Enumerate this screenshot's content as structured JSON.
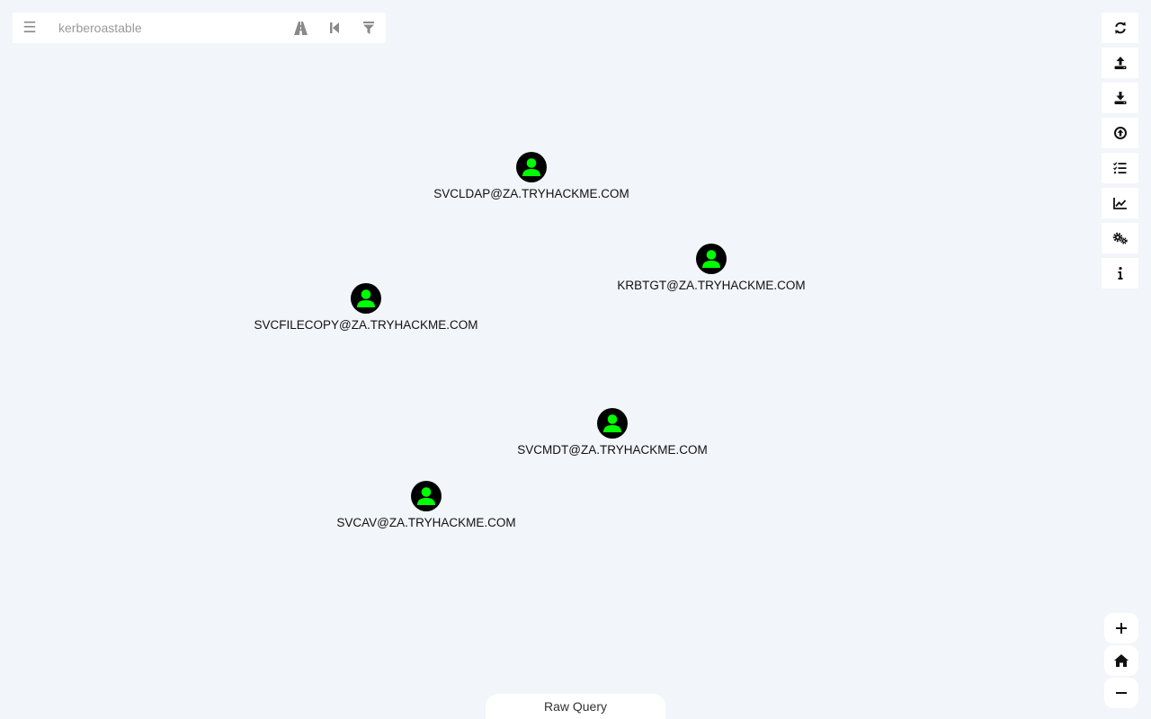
{
  "search": {
    "value": "",
    "placeholder": "kerberoastable",
    "menu_icon": "hamburger-menu-icon",
    "icons": [
      "pathfinding-road-icon",
      "back-icon",
      "filter-icon"
    ]
  },
  "toolbar": {
    "buttons": [
      {
        "name": "refresh-button",
        "icon": "refresh-icon"
      },
      {
        "name": "export-graph-button",
        "icon": "export-icon"
      },
      {
        "name": "import-graph-button",
        "icon": "import-icon"
      },
      {
        "name": "upload-data-button",
        "icon": "upload-circle-icon"
      },
      {
        "name": "queries-button",
        "icon": "task-list-icon"
      },
      {
        "name": "database-info-button",
        "icon": "line-chart-icon"
      },
      {
        "name": "settings-button",
        "icon": "gears-icon"
      },
      {
        "name": "about-button",
        "icon": "info-icon"
      }
    ]
  },
  "zoom": {
    "in_label": "+",
    "home_icon": "home-icon",
    "out_label": "−"
  },
  "nodes": [
    {
      "label": "SVCLDAP@ZA.TRYHACKME.COM",
      "type": "user",
      "color": "#00ff00"
    },
    {
      "label": "KRBTGT@ZA.TRYHACKME.COM",
      "type": "user",
      "color": "#00ff00"
    },
    {
      "label": "SVCFILECOPY@ZA.TRYHACKME.COM",
      "type": "user",
      "color": "#00ff00"
    },
    {
      "label": "SVCMDT@ZA.TRYHACKME.COM",
      "type": "user",
      "color": "#00ff00"
    },
    {
      "label": "SVCAV@ZA.TRYHACKME.COM",
      "type": "user",
      "color": "#00ff00"
    }
  ],
  "raw_query": {
    "label": "Raw Query"
  },
  "colors": {
    "background": "#f2f5f9",
    "node_fill": "#000000",
    "user_icon": "#00ff00"
  }
}
